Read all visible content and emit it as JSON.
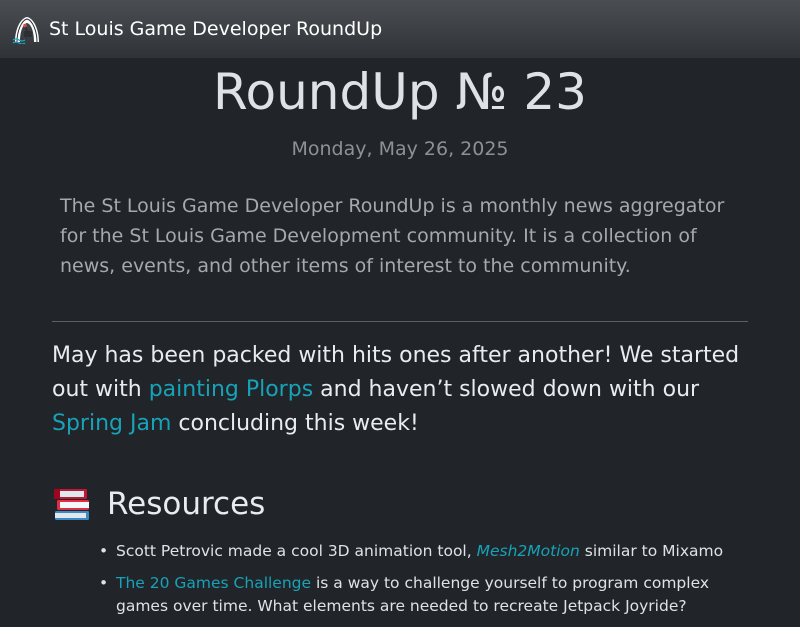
{
  "navbar": {
    "brand_name": "St Louis Game Developer RoundUp",
    "logo_icon": "arch-joystick-logo-icon"
  },
  "main": {
    "title": "RoundUp № 23",
    "date": "Monday, May 26, 2025",
    "intro": "The St Louis Game Developer RoundUp is a monthly news aggregator for the St Louis Game Development community. It is a collection of news, events, and other items of interest to the community.",
    "lead": {
      "text_1": "May has been packed with hits ones after another! We started out with ",
      "link_1": "painting Plorps",
      "text_2": " and haven’t slowed down with our ",
      "link_2": "Spring Jam",
      "text_3": " concluding this week!"
    },
    "resources": {
      "heading": "Resources",
      "heading_icon": "books-icon",
      "items": [
        {
          "text_before": "Scott Petrovic made a cool 3D animation tool, ",
          "link": "Mesh2Motion",
          "text_after": " similar to Mixamo"
        },
        {
          "link": "The 20 Games Challenge",
          "text_after": " is a way to challenge yourself to program complex games over time. What elements are needed to recreate Jetpack Joyride?"
        }
      ]
    }
  },
  "colors": {
    "background": "#212529",
    "link": "#17a2b8",
    "navbar": "#3d4145"
  }
}
